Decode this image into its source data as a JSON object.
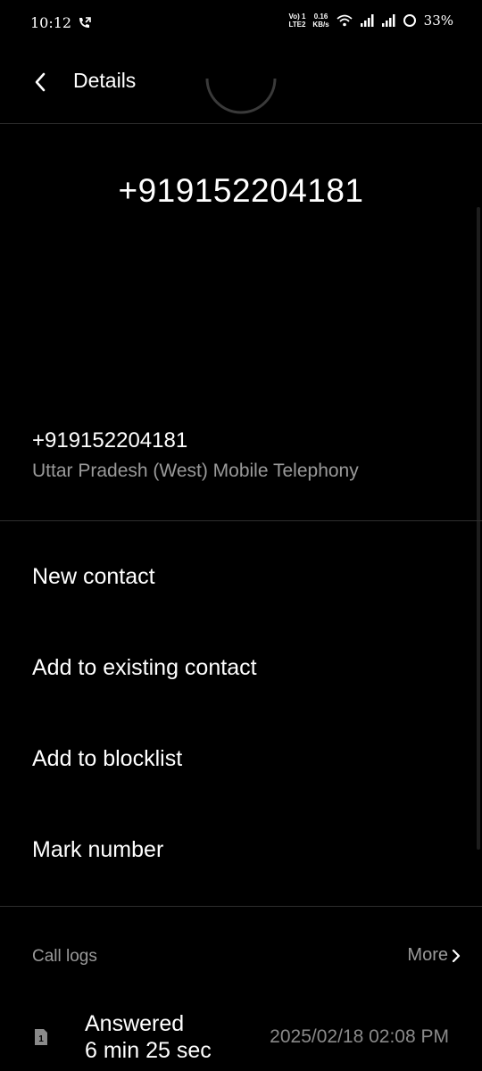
{
  "status_bar": {
    "time": "10:12",
    "network_top": "Vo) 1",
    "network_bottom": "LTE2",
    "speed_top": "0.16",
    "speed_bottom": "KB/s",
    "battery": "33%"
  },
  "header": {
    "title": "Details"
  },
  "contact": {
    "hero_number": "+919152204181",
    "number": "+919152204181",
    "carrier": "Uttar Pradesh (West) Mobile Telephony"
  },
  "actions": [
    {
      "label": "New contact"
    },
    {
      "label": "Add to existing contact"
    },
    {
      "label": "Add to blocklist"
    },
    {
      "label": "Mark number"
    }
  ],
  "call_logs": {
    "title": "Call logs",
    "more_label": "More",
    "entries": [
      {
        "sim": "1",
        "status": "Answered",
        "duration": "6 min 25 sec",
        "datetime": "2025/02/18 02:08 PM"
      }
    ]
  },
  "colors": {
    "background": "#000000",
    "primary_text": "#ffffff",
    "secondary_text": "#9a9a9a",
    "divider": "#2e2e2e"
  }
}
